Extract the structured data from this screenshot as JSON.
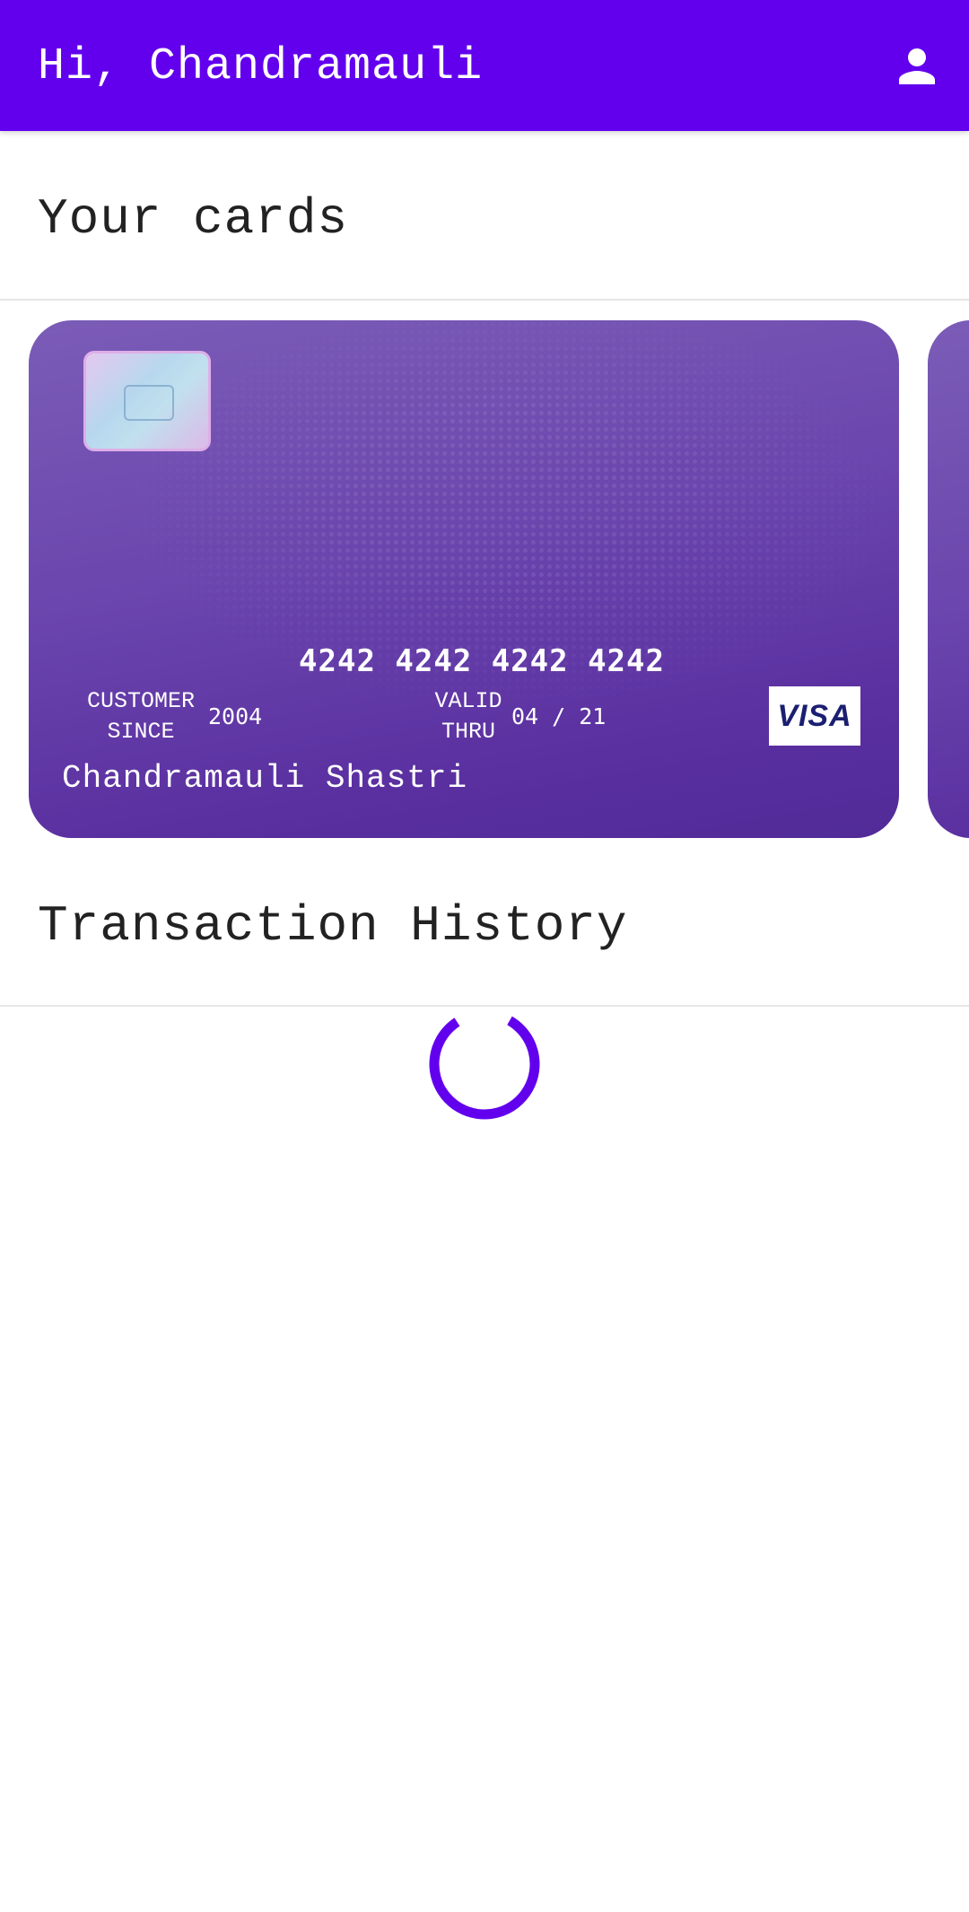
{
  "appbar": {
    "greeting": "Hi, Chandramauli",
    "account_icon": "account-icon",
    "color": "#6200ee"
  },
  "cards_section": {
    "title": "Your cards",
    "cards": [
      {
        "number": "4242 4242 4242 4242",
        "customer_since_label": "Customer since",
        "customer_since_value": "2004",
        "valid_thru_label": "Valid thru",
        "valid_thru_value": "04 / 21",
        "holder": "Chandramauli Shastri",
        "brand": "VISA"
      }
    ]
  },
  "transactions_section": {
    "title": "Transaction History",
    "loading": true
  }
}
